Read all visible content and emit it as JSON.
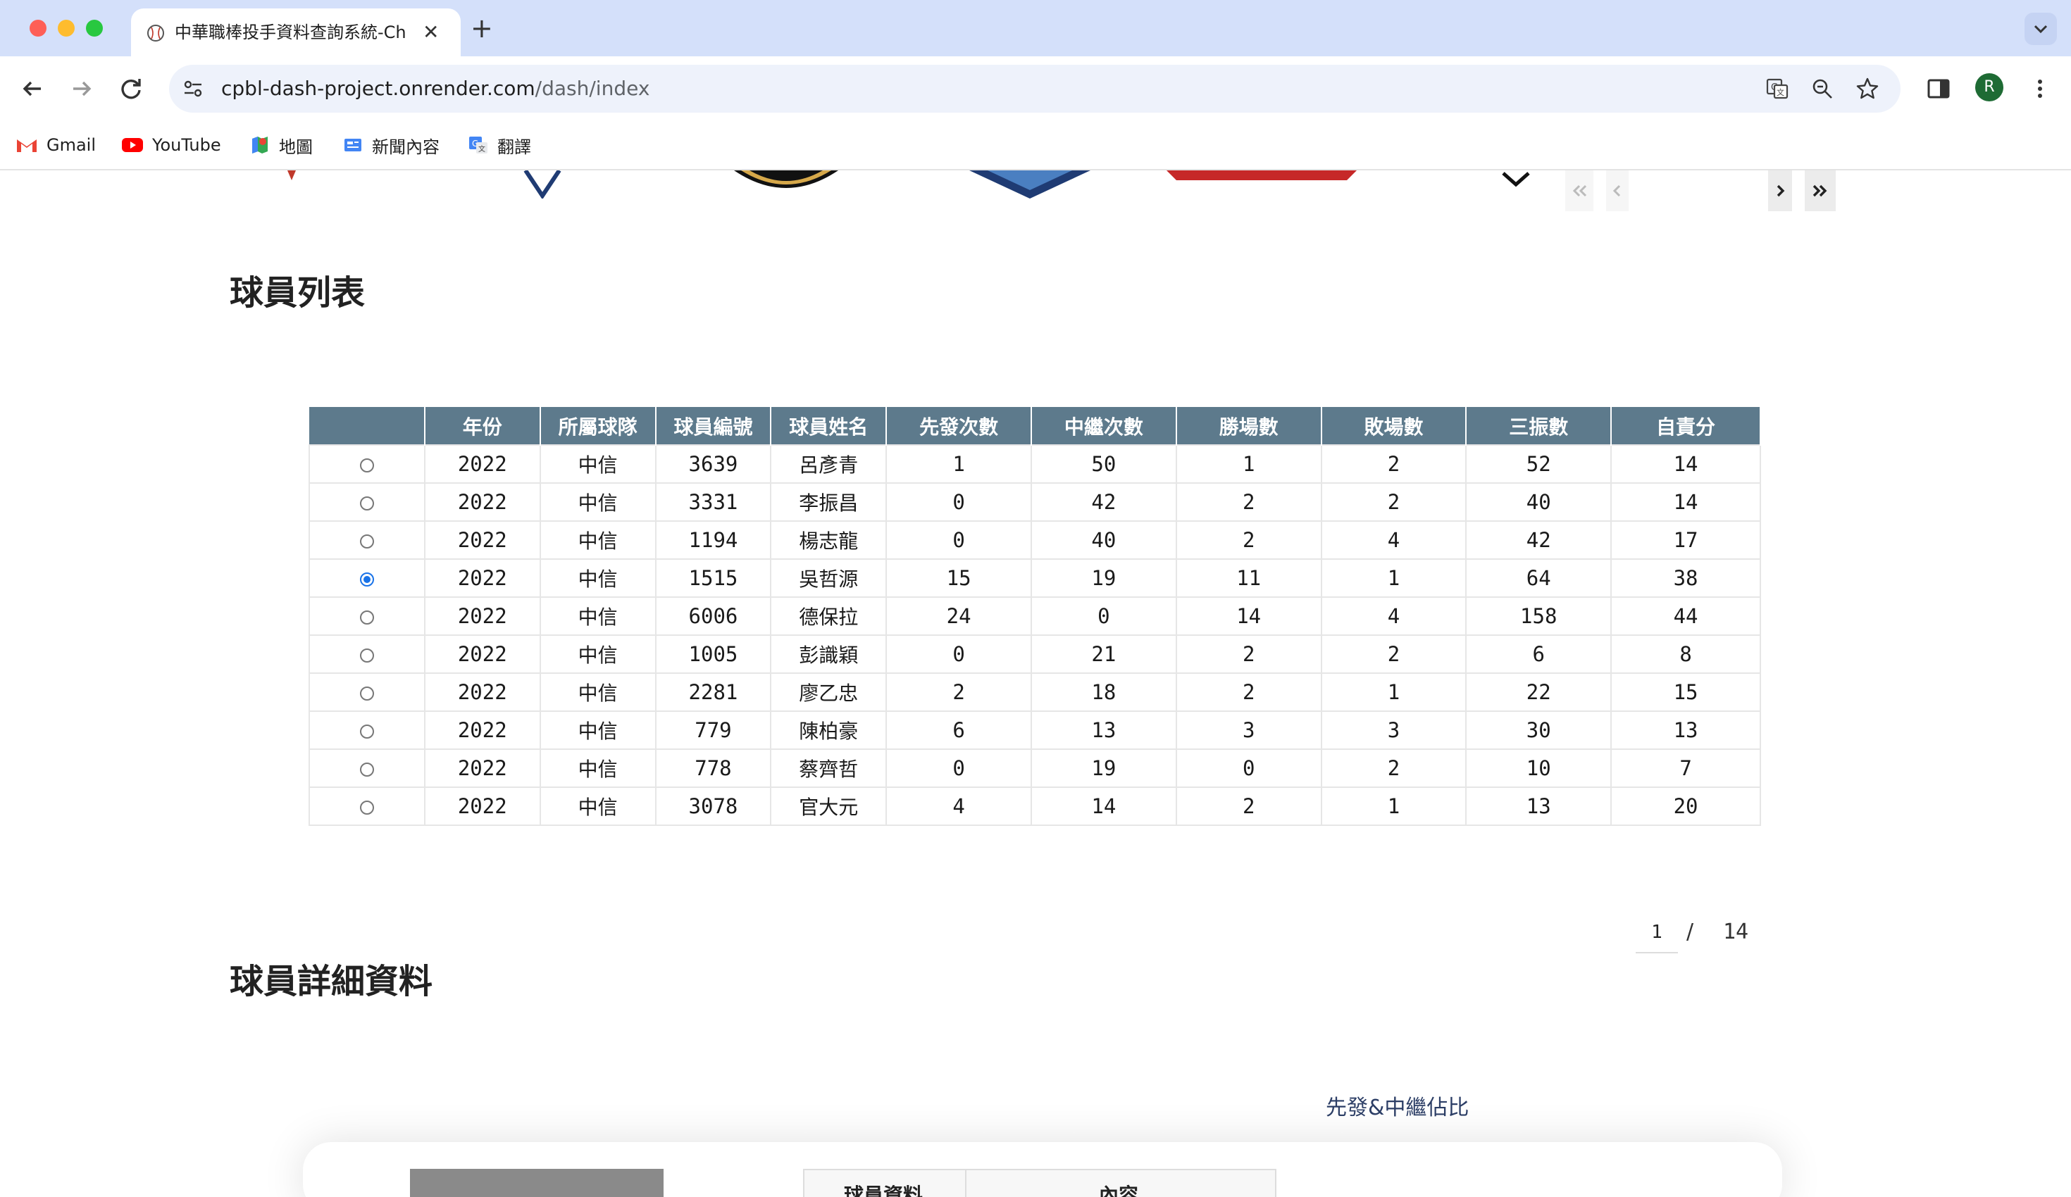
{
  "browser": {
    "tab_title": "中華職棒投手資料查詢系統-Ch",
    "url_domain": "cpbl-dash-project.onrender.com",
    "url_path": "/dash/index",
    "avatar_letter": "R",
    "bookmarks": [
      {
        "label": "Gmail",
        "icon": "gmail-icon"
      },
      {
        "label": "YouTube",
        "icon": "youtube-icon"
      },
      {
        "label": "地圖",
        "icon": "maps-icon"
      },
      {
        "label": "新聞內容",
        "icon": "news-icon"
      },
      {
        "label": "翻譯",
        "icon": "translate-icon"
      }
    ]
  },
  "page": {
    "player_list_title": "球員列表",
    "player_detail_title": "球員詳細資料",
    "chart_title": "先發&中繼佔比",
    "detail_table": {
      "col1": "球員資料",
      "col2": "內容"
    }
  },
  "table": {
    "columns": [
      "",
      "年份",
      "所屬球隊",
      "球員編號",
      "球員姓名",
      "先發次數",
      "中繼次數",
      "勝場數",
      "敗場數",
      "三振數",
      "自責分"
    ],
    "rows": [
      {
        "selected": false,
        "cells": [
          "2022",
          "中信",
          "3639",
          "呂彥青",
          "1",
          "50",
          "1",
          "2",
          "52",
          "14"
        ]
      },
      {
        "selected": false,
        "cells": [
          "2022",
          "中信",
          "3331",
          "李振昌",
          "0",
          "42",
          "2",
          "2",
          "40",
          "14"
        ]
      },
      {
        "selected": false,
        "cells": [
          "2022",
          "中信",
          "1194",
          "楊志龍",
          "0",
          "40",
          "2",
          "4",
          "42",
          "17"
        ]
      },
      {
        "selected": true,
        "cells": [
          "2022",
          "中信",
          "1515",
          "吳哲源",
          "15",
          "19",
          "11",
          "1",
          "64",
          "38"
        ]
      },
      {
        "selected": false,
        "cells": [
          "2022",
          "中信",
          "6006",
          "德保拉",
          "24",
          "0",
          "14",
          "4",
          "158",
          "44"
        ]
      },
      {
        "selected": false,
        "cells": [
          "2022",
          "中信",
          "1005",
          "彭識穎",
          "0",
          "21",
          "2",
          "2",
          "6",
          "8"
        ]
      },
      {
        "selected": false,
        "cells": [
          "2022",
          "中信",
          "2281",
          "廖乙忠",
          "2",
          "18",
          "2",
          "1",
          "22",
          "15"
        ]
      },
      {
        "selected": false,
        "cells": [
          "2022",
          "中信",
          "779",
          "陳柏豪",
          "6",
          "13",
          "3",
          "3",
          "30",
          "13"
        ]
      },
      {
        "selected": false,
        "cells": [
          "2022",
          "中信",
          "778",
          "蔡齊哲",
          "0",
          "19",
          "0",
          "2",
          "10",
          "7"
        ]
      },
      {
        "selected": false,
        "cells": [
          "2022",
          "中信",
          "3078",
          "官大元",
          "4",
          "14",
          "2",
          "1",
          "13",
          "20"
        ]
      }
    ]
  },
  "pagination": {
    "current": "1",
    "separator": "/",
    "total": "14"
  },
  "colors": {
    "table_header": "#5d7a8c",
    "radio_selected": "#1a73e8",
    "tabbar": "#d4e0fa"
  }
}
